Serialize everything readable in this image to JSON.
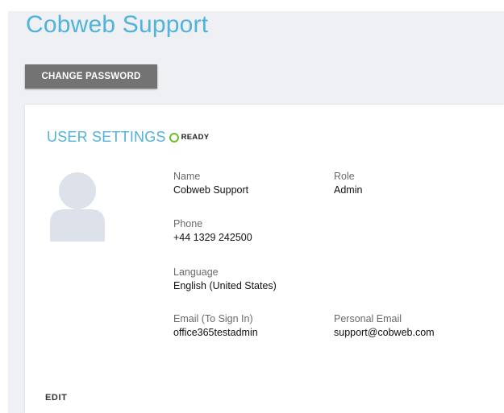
{
  "header": {
    "title": "Cobweb Support"
  },
  "actions": {
    "change_password_label": "CHANGE PASSWORD"
  },
  "settings": {
    "title": "USER SETTINGS",
    "status": "READY",
    "status_color": "#6cbf2a",
    "avatar_icon": "user-silhouette-icon",
    "fields": {
      "name": {
        "label": "Name",
        "value": "Cobweb Support"
      },
      "role": {
        "label": "Role",
        "value": "Admin"
      },
      "phone": {
        "label": "Phone",
        "value": "+44 1329 242500"
      },
      "language": {
        "label": "Language",
        "value": "English (United States)"
      },
      "email_signin": {
        "label": "Email (To Sign In)",
        "value": "office365testadmin"
      },
      "personal_email": {
        "label": "Personal Email",
        "value": "support@cobweb.com"
      }
    },
    "edit_label": "EDIT"
  },
  "colors": {
    "accent": "#4fb3dc",
    "button_bg": "#737373",
    "page_bg": "#eef0f3"
  }
}
